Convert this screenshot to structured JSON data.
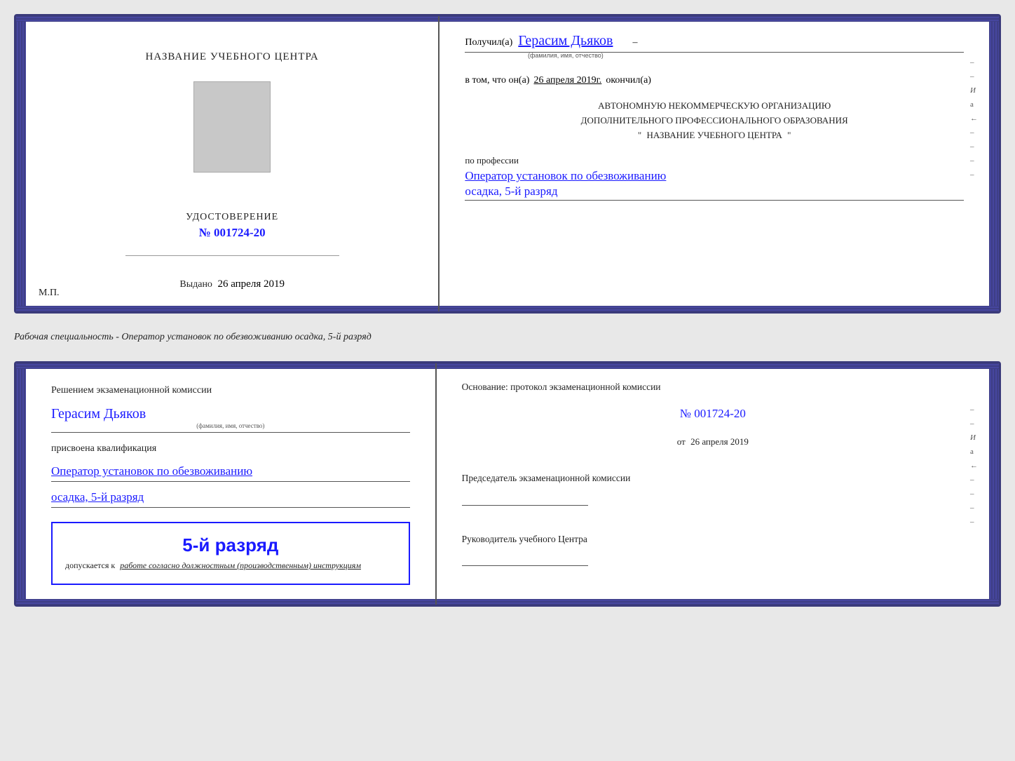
{
  "top_card": {
    "left": {
      "school_name": "НАЗВАНИЕ УЧЕБНОГО ЦЕНТРА",
      "cert_label": "УДОСТОВЕРЕНИЕ",
      "cert_number_prefix": "№",
      "cert_number": "001724-20",
      "issued_label": "Выдано",
      "issued_date": "26 апреля 2019",
      "mp_label": "М.П."
    },
    "right": {
      "received_prefix": "Получил(а)",
      "recipient_name": "Герасим Дьяков",
      "name_sublabel": "(фамилия, имя, отчество)",
      "in_that_prefix": "в том, что он(а)",
      "date_text": "26 апреля 2019г.",
      "finished_label": "окончил(а)",
      "org_line1": "АВТОНОМНУЮ НЕКОММЕРЧЕСКУЮ ОРГАНИЗАЦИЮ",
      "org_line2": "ДОПОЛНИТЕЛЬНОГО ПРОФЕССИОНАЛЬНОГО ОБРАЗОВАНИЯ",
      "org_quote_open": "\"",
      "org_name": "НАЗВАНИЕ УЧЕБНОГО ЦЕНТРА",
      "org_quote_close": "\"",
      "profession_label": "по профессии",
      "profession_name": "Оператор установок по обезвоживанию",
      "profession_grade": "осадка, 5-й разряд"
    }
  },
  "separator": {
    "text": "Рабочая специальность - Оператор установок по обезвоживанию осадка, 5-й разряд"
  },
  "bottom_card": {
    "left": {
      "decision_label": "Решением экзаменационной комиссии",
      "person_name": "Герасим Дьяков",
      "name_sublabel": "(фамилия, имя, отчество)",
      "qualification_label": "присвоена квалификация",
      "qualification_line1": "Оператор установок по обезвоживанию",
      "qualification_line2": "осадка, 5-й разряд",
      "stamp_big": "5-й разряд",
      "stamp_small_prefix": "допускается к",
      "stamp_small_italic": "работе согласно должностным (производственным) инструкциям"
    },
    "right": {
      "basis_label": "Основание: протокол экзаменационной комиссии",
      "protocol_number": "№  001724-20",
      "date_prefix": "от",
      "date_text": "26 апреля 2019",
      "chairman_label": "Председатель экзаменационной комиссии",
      "director_label": "Руководитель учебного Центра"
    }
  },
  "side_letters": [
    "И",
    "а",
    "←",
    "–",
    "–",
    "–",
    "–",
    "–"
  ]
}
